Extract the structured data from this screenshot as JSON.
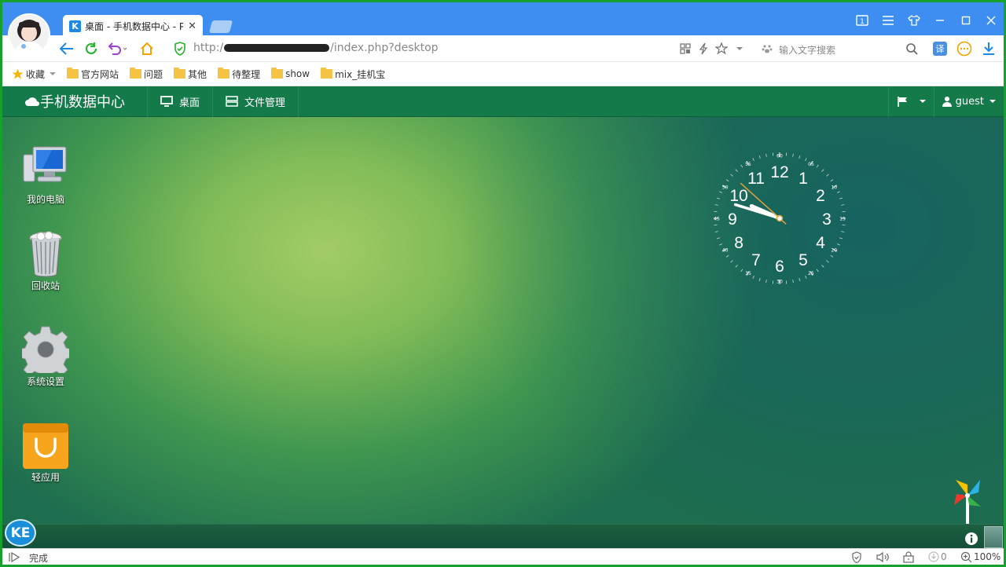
{
  "browser": {
    "tab_title": "桌面 - 手机数据中心 - P",
    "url_prefix": "http:/",
    "url_suffix": "/index.php?desktop",
    "search_placeholder": "输入文字搜索",
    "translate_icon": "译"
  },
  "bookmarks": {
    "favorites_label": "收藏",
    "items": [
      "官方网站",
      "问题",
      "其他",
      "待整理",
      "show",
      "mix_挂机宝"
    ]
  },
  "appnav": {
    "brand": "手机数据中心",
    "desktop_label": "桌面",
    "files_label": "文件管理",
    "user_label": "guest"
  },
  "desktop": {
    "icons": [
      {
        "label": "我的电脑",
        "icon": "computer-icon"
      },
      {
        "label": "回收站",
        "icon": "recycle-bin-icon"
      },
      {
        "label": "系统设置",
        "icon": "gear-icon"
      },
      {
        "label": "轻应用",
        "icon": "shopping-bag-icon"
      }
    ]
  },
  "clock": {
    "time": "9:47:52",
    "hour_numbers": [
      "12",
      "1",
      "2",
      "3",
      "4",
      "5",
      "6",
      "7",
      "8",
      "9",
      "10",
      "11"
    ],
    "minute_labels": [
      "60",
      "05",
      "10",
      "15",
      "20",
      "25",
      "30",
      "35",
      "40",
      "45",
      "50",
      "55"
    ]
  },
  "taskbar": {
    "start_label": "KE"
  },
  "statusbar": {
    "status": "完成",
    "download_count": "0",
    "zoom": "100%"
  },
  "colors": {
    "titlebar": "#3d8ef0",
    "appnav": "#157a4a",
    "frame": "#16a02c"
  }
}
